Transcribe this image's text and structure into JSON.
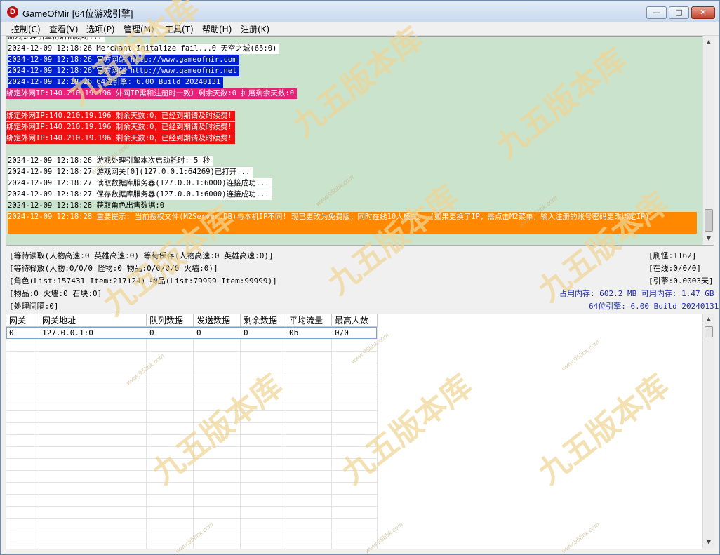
{
  "window": {
    "title": "GameOfMir [64位游戏引擎]",
    "app_icon_letter": "D",
    "minimize_glyph": "—",
    "maximize_glyph": "□",
    "close_glyph": "✕"
  },
  "menu": [
    "控制(C)",
    "查看(V)",
    "选项(P)",
    "管理(M)",
    "工具(T)",
    "帮助(H)",
    "注册(K)"
  ],
  "log": {
    "truncated_top": "游戏处理引擎初始化成功...",
    "lines": [
      {
        "text": "2024-12-09 12:18:26 Merchant Initalize fail...0 天空之城(65:0)",
        "style": "white"
      },
      {
        "text": "2024-12-09 12:18:26 官方网站 http://www.gameofmir.com",
        "style": "blue"
      },
      {
        "text": "2024-12-09 12:18:26 官方网站 http://www.gameofmir.net",
        "style": "blue"
      },
      {
        "text": "2024-12-09 12:18:26 64位引擎: 6.00 Build 20240131",
        "style": "blue"
      },
      {
        "text": "绑定外网IP:140.210.19.196 外网IP需和注册时一致）剩余天数:0 扩展剩余天数:0",
        "style": "pink"
      },
      {
        "text": "",
        "style": "plain"
      },
      {
        "text": "绑定外网IP:140.210.19.196 剩余天数:0，已经到期请及时续费!",
        "style": "red"
      },
      {
        "text": "绑定外网IP:140.210.19.196 剩余天数:0，已经到期请及时续费!",
        "style": "red"
      },
      {
        "text": "绑定外网IP:140.210.19.196 剩余天数:0，已经到期请及时续费!",
        "style": "red"
      },
      {
        "text": "",
        "style": "plain"
      },
      {
        "text": "2024-12-09 12:18:26 游戏处理引擎本次启动耗时: 5 秒",
        "style": "white"
      },
      {
        "text": "2024-12-09 12:18:27 游戏网关[0](127.0.0.1:64269)已打开...",
        "style": "white"
      },
      {
        "text": "2024-12-09 12:18:27 读取数据库服务器(127.0.0.1:6000)连接成功...",
        "style": "white"
      },
      {
        "text": "2024-12-09 12:18:27 保存数据库服务器(127.0.0.1:6000)连接成功...",
        "style": "white"
      },
      {
        "text": "2024-12-09 12:18:28 获取角色出售数据:0",
        "style": "plain"
      },
      {
        "text": "2024-12-09 12:18:28 重要提示: 当前授权文件(M2Server.DB)与本机IP不同! 现已更改为免费版，同时在线10人模式。 (如果更换了IP，需点击M2菜单，输入注册的账号密码更改绑定IP)",
        "style": "orange"
      }
    ]
  },
  "status": {
    "wait_read": "[等待读取(人物高速:0 英雄高速:0) 等待保存(人物高速:0 英雄高速:0)]",
    "wait_release": "[等待释放(人物:0/0/0 怪物:0 物品:0/0/0/0 火墙:0)]",
    "role": "[角色(List:157431 Item:217124) 物品(List:79999 Item:99999)]",
    "items": "[物品:0 火墙:0 石块:0]",
    "interval": "[处理间隔:0]",
    "refresh": "[刷怪:1162]",
    "online": "[在线:0/0/0]",
    "engine_time": "[引擎:0.0003天]",
    "memory": "占用内存: 602.2 MB 可用内存: 1.47 GB",
    "build": "64位引擎: 6.00 Build 20240131"
  },
  "table": {
    "columns": [
      "网关",
      "网关地址",
      "队列数据",
      "发送数据",
      "剩余数据",
      "平均流量",
      "最高人数"
    ],
    "rows": [
      [
        "0",
        "127.0.0.1:0",
        "0",
        "0",
        "0",
        "0b",
        "0/0"
      ]
    ]
  },
  "watermark": {
    "text": "九五版本库",
    "url": "www.95bbk.com"
  },
  "colors": {
    "log_bg": "#cae3cc",
    "blue_line": "#0020d0",
    "pink_line": "#e8207a",
    "red_line": "#f01010",
    "orange_line": "#ff8800",
    "status_blue": "#1c2cb0"
  }
}
